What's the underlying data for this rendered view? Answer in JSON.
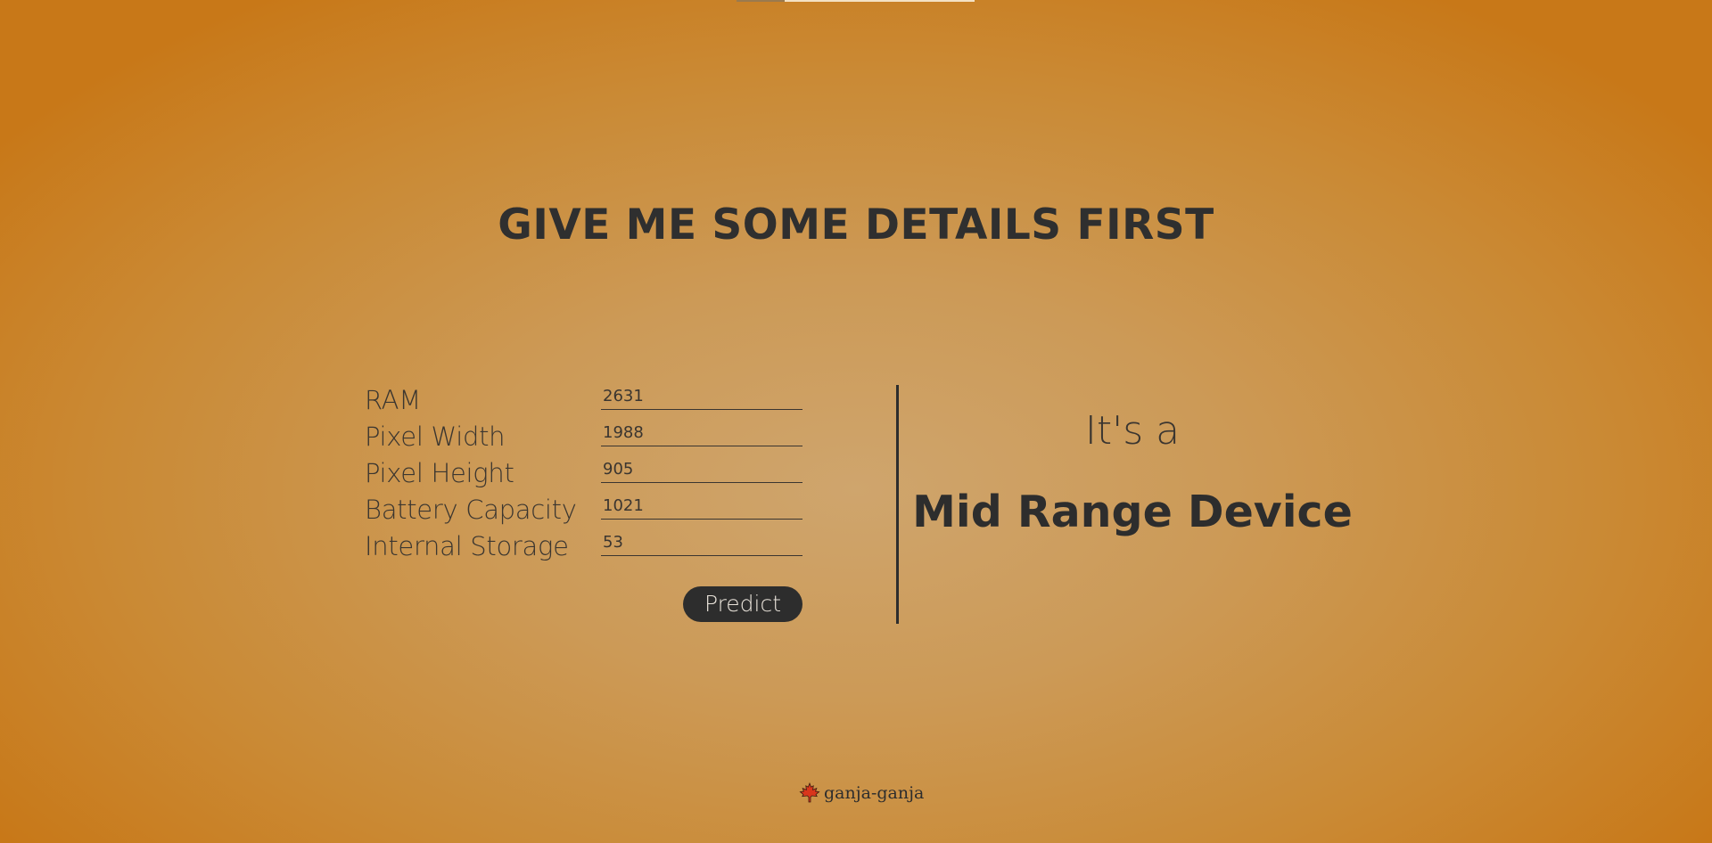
{
  "page": {
    "title": "GIVE ME SOME DETAILS FIRST"
  },
  "form": {
    "fields": [
      {
        "label": "RAM",
        "value": "2631"
      },
      {
        "label": "Pixel Width",
        "value": "1988"
      },
      {
        "label": "Pixel Height",
        "value": "905"
      },
      {
        "label": "Battery Capacity",
        "value": "1021"
      },
      {
        "label": "Internal Storage",
        "value": "53"
      }
    ],
    "submit_label": "Predict"
  },
  "result": {
    "prefix": "It's a",
    "prediction": "Mid Range Device"
  },
  "footer": {
    "icon": "maple-leaf-icon",
    "text": "ganja-ganja"
  },
  "colors": {
    "background_center": "#cfa56d",
    "background_edge": "#c87818",
    "text_dark": "#2d2d2d",
    "button_bg": "#2d2d2d",
    "button_text": "#e9e3da",
    "leaf": "#d9361c"
  }
}
